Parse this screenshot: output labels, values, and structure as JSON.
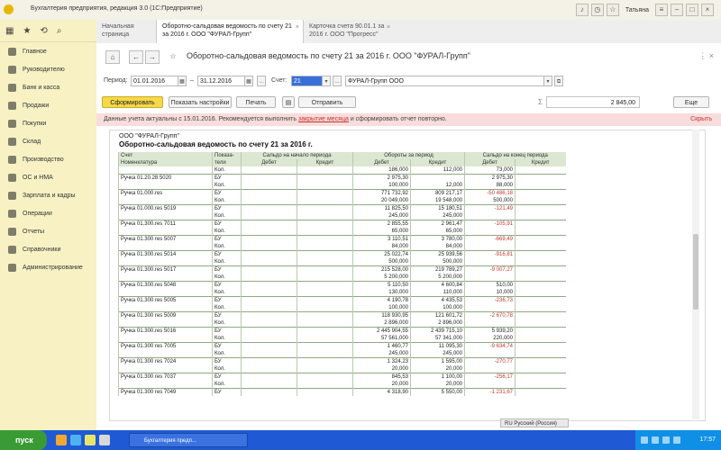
{
  "window": {
    "title": "Бухгалтерия предприятия, редакция 3.0 (1С:Предприятие)",
    "user": "Татьяна"
  },
  "sidebar": {
    "items": [
      {
        "label": "Главное",
        "icon": "list-icon"
      },
      {
        "label": "Руководителю",
        "icon": "chart-icon"
      },
      {
        "label": "Банк и касса",
        "icon": "bank-icon"
      },
      {
        "label": "Продажи",
        "icon": "sales-icon"
      },
      {
        "label": "Покупки",
        "icon": "cart-icon"
      },
      {
        "label": "Склад",
        "icon": "warehouse-icon"
      },
      {
        "label": "Производство",
        "icon": "factory-icon"
      },
      {
        "label": "ОС и НМА",
        "icon": "assets-icon"
      },
      {
        "label": "Зарплата и кадры",
        "icon": "people-icon"
      },
      {
        "label": "Операции",
        "icon": "operations-icon"
      },
      {
        "label": "Отчеты",
        "icon": "reports-icon"
      },
      {
        "label": "Справочники",
        "icon": "book-icon"
      },
      {
        "label": "Администрирование",
        "icon": "gear-icon"
      }
    ]
  },
  "tabs": [
    {
      "label": "Начальная страница"
    },
    {
      "label": "Оборотно-сальдовая ведомость по счету 21 за 2016 г. ООО \"ФУРАЛ-Групп\""
    },
    {
      "label": "Карточка счета 90.01.1 за 2016 г. ООО \"Прогресс\""
    }
  ],
  "header": {
    "title": "Оборотно-сальдовая ведомость по счету 21 за 2016 г. ООО \"ФУРАЛ-Групп\"",
    "more": "⋮ ×"
  },
  "filters": {
    "period_label": "Период:",
    "date_from": "01.01.2016",
    "dash": "–",
    "date_to": "31.12.2016",
    "account_label": "Счет:",
    "account": "21",
    "org": "ФУРАЛ-Групп ООО"
  },
  "toolbar": {
    "generate": "Сформировать",
    "show_settings": "Показать настройки",
    "print": "Печать",
    "send": "Отправить",
    "sum_label": "Σ",
    "sum_value": "2 845,00",
    "more": "Еще"
  },
  "warning": {
    "text": "Данные учета актуальны с 15.01.2016. Рекомендуется выполнить",
    "link": "закрытие месяца",
    "text2": "и сформировать отчет повторно.",
    "close": "Скрыть"
  },
  "report": {
    "org": "ООО \"ФУРАЛ-Групп\"",
    "title": "Оборотно-сальдовая ведомость по счету 21 за 2016 г.",
    "head1": [
      "Счет",
      "Показа-",
      "Сальдо на начало периода",
      "Обороты за период",
      "Сальдо на конец периода"
    ],
    "head2": [
      "Номенклатура",
      "тели",
      "Дебет",
      "Кредит",
      "Дебет",
      "Кредит",
      "Дебет",
      "Кредит"
    ],
    "rows": [
      {
        "name": "",
        "ind": "Кол.",
        "od": "186,000",
        "oc": "112,000",
        "ed": "73,000"
      },
      {
        "name": "Ручка 01.20.28 5020",
        "ind": "БУ",
        "od": "2 975,30",
        "oc": "",
        "ed": "2 975,30"
      },
      {
        "name": "",
        "ind": "Кол.",
        "od": "100,000",
        "oc": "12,000",
        "ed": "88,000"
      },
      {
        "name": "Ручка 01.000.res",
        "ind": "БУ",
        "od": "771 732,92",
        "oc": "809 217,17",
        "ed": "-50 486,18",
        "red": true
      },
      {
        "name": "",
        "ind": "Кол.",
        "od": "20 049,000",
        "oc": "19 548,000",
        "ed": "500,000"
      },
      {
        "name": "Ручка 01.000.res 5019",
        "ind": "БУ",
        "od": "11 825,50",
        "oc": "15 180,51",
        "ed": "-121,49",
        "red": true
      },
      {
        "name": "",
        "ind": "Кол.",
        "od": "245,000",
        "oc": "245,000",
        "ed": ""
      },
      {
        "name": "Ручка 01.300.res 7011",
        "ind": "БУ",
        "od": "2 855,55",
        "oc": "2 961,47",
        "ed": "-105,91",
        "red": true
      },
      {
        "name": "",
        "ind": "Кол.",
        "od": "65,000",
        "oc": "65,000",
        "ed": ""
      },
      {
        "name": "Ручка 01.300 res 5007",
        "ind": "БУ",
        "od": "3 110,51",
        "oc": "3 780,00",
        "ed": "-669,49",
        "red": true
      },
      {
        "name": "",
        "ind": "Кол.",
        "od": "84,000",
        "oc": "84,000",
        "ed": ""
      },
      {
        "name": "Ручка 01.300.res 5014",
        "ind": "БУ",
        "od": "25 022,74",
        "oc": "25 939,56",
        "ed": "-916,81",
        "red": true
      },
      {
        "name": "",
        "ind": "Кол.",
        "od": "500,000",
        "oc": "500,000",
        "ed": ""
      },
      {
        "name": "Ручка 01.300.res 5017",
        "ind": "БУ",
        "od": "215 528,00",
        "oc": "219 789,27",
        "ed": "-9 007,27",
        "red": true
      },
      {
        "name": "",
        "ind": "Кол.",
        "od": "5 200,000",
        "oc": "5 200,000",
        "ed": ""
      },
      {
        "name": "Ручка 01.300.res 5048",
        "ind": "БУ",
        "od": "5 110,50",
        "oc": "4 600,84",
        "ed": "510,00"
      },
      {
        "name": "",
        "ind": "Кол.",
        "od": "130,000",
        "oc": "110,000",
        "ed": "10,000"
      },
      {
        "name": "Ручка 01.300 res 5005",
        "ind": "БУ",
        "od": "4 190,78",
        "oc": "4 435,53",
        "ed": "-236,73",
        "red": true
      },
      {
        "name": "",
        "ind": "Кол.",
        "od": "100,000",
        "oc": "100,000",
        "ed": ""
      },
      {
        "name": "Ручка 01.300 res 5009",
        "ind": "БУ",
        "od": "118 930,95",
        "oc": "121 601,72",
        "ed": "-2 670,78",
        "red": true
      },
      {
        "name": "",
        "ind": "Кол.",
        "od": "2 896,000",
        "oc": "2 896,000",
        "ed": ""
      },
      {
        "name": "Ручка 01.300.res 5016",
        "ind": "БУ",
        "od": "2 445 904,55",
        "oc": "2 439 715,10",
        "ed": "5 939,20"
      },
      {
        "name": "",
        "ind": "Кол.",
        "od": "57 561,000",
        "oc": "57 341,000",
        "ed": "220,000"
      },
      {
        "name": "Ручка 01.300 res 7005",
        "ind": "БУ",
        "od": "1 460,77",
        "oc": "11 095,30",
        "ed": "-9 634,74",
        "red": true
      },
      {
        "name": "",
        "ind": "Кол.",
        "od": "245,000",
        "oc": "245,000",
        "ed": ""
      },
      {
        "name": "Ручка 01.300 res 7024",
        "ind": "БУ",
        "od": "1 324,23",
        "oc": "1 595,00",
        "ed": "-270,77",
        "red": true
      },
      {
        "name": "",
        "ind": "Кол.",
        "od": "20,000",
        "oc": "20,000",
        "ed": ""
      },
      {
        "name": "Ручка 01.300 res 7037",
        "ind": "БУ",
        "od": "845,53",
        "oc": "1 100,00",
        "ed": "-256,17",
        "red": true
      },
      {
        "name": "",
        "ind": "Кол.",
        "od": "20,000",
        "oc": "20,000",
        "ed": ""
      },
      {
        "name": "Ручка 01.300 res 7049",
        "ind": "БУ",
        "od": "4 318,90",
        "oc": "5 550,00",
        "ed": "-1 231,67",
        "red": true
      }
    ]
  },
  "keyboard": "RU Русский (Россия)",
  "taskbar": {
    "start": "пуск",
    "task": "Бухгалтерия предп...",
    "time": "17:57"
  }
}
